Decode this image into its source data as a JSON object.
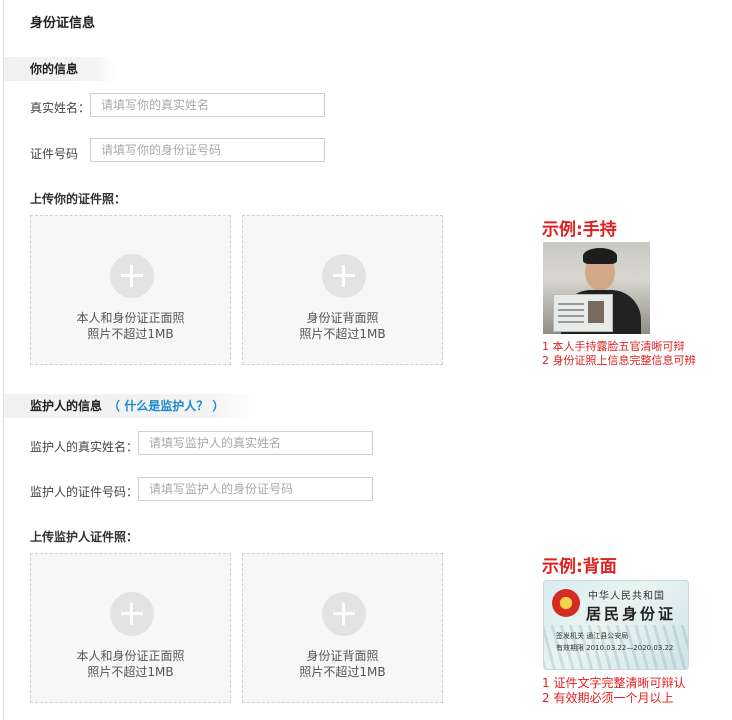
{
  "page": {
    "title": "身份证信息"
  },
  "your_info": {
    "heading": "你的信息",
    "name_label": "真实姓名：",
    "name_placeholder": "请填写你的真实姓名",
    "id_label": "证件号码",
    "id_placeholder": "请填写你的身份证号码",
    "upload_title": "上传你的证件照：",
    "upload_front": {
      "line1": "本人和身份证正面照",
      "line2": "照片不超过1MB"
    },
    "upload_back": {
      "line1": "身份证背面照",
      "line2": "照片不超过1MB"
    },
    "example_title": "示例:手持",
    "notes": [
      "1 本人手持露脸五官清晰可辩",
      "2 身份证照上信息完整信息可辨"
    ]
  },
  "guardian_info": {
    "heading": "监护人的信息",
    "help_link": "（ 什么是监护人？ ）",
    "name_label": "监护人的真实姓名：",
    "name_placeholder": "请填写监护人的真实姓名",
    "id_label": "监护人的证件号码：",
    "id_placeholder": "请填写监护人的身份证号码",
    "upload_title": "上传监护人证件照：",
    "upload_front": {
      "line1": "本人和身份证正面照",
      "line2": "照片不超过1MB"
    },
    "upload_back": {
      "line1": "身份证背面照",
      "line2": "照片不超过1MB"
    },
    "example_title": "示例:背面",
    "card_text": {
      "country": "中华人民共和国",
      "title": "居民身份证",
      "issuer": "签发机关  通江县公安局",
      "validity": "有效期限  2010.03.22—2020.03.22"
    },
    "notes": [
      "1 证件文字完整清晰可辩认",
      "2 有效期必须一个月以上"
    ]
  },
  "colors": {
    "accent_red": "#e02020",
    "link_blue": "#1a8bc8",
    "box_bg": "#f7f7f7"
  },
  "icons": {
    "upload": "plus-circle-icon"
  }
}
